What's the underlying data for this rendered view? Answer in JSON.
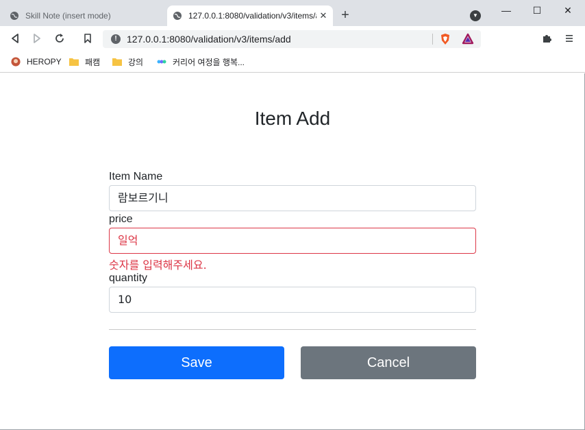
{
  "browser": {
    "tabs": [
      {
        "title": "Skill Note (insert mode)",
        "active": false
      },
      {
        "title": "127.0.0.1:8080/validation/v3/items/add",
        "active": true
      }
    ],
    "new_tab": "+",
    "window_buttons": {
      "minimize": "—",
      "maximize": "☐",
      "close": "✕"
    },
    "url": "127.0.0.1:8080/validation/v3/items/add",
    "bookmarks": [
      {
        "label": "HEROPY",
        "icon": "avatar-icon"
      },
      {
        "label": "패캠",
        "icon": "folder-icon"
      },
      {
        "label": "강의",
        "icon": "folder-icon"
      },
      {
        "label": "커리어 여정을 행복...",
        "icon": "dots-logo-icon"
      }
    ]
  },
  "form": {
    "title": "Item Add",
    "item_name": {
      "label": "Item Name",
      "value": "람보르기니"
    },
    "price": {
      "label": "price",
      "value": "일억",
      "error": "숫자를 입력해주세요."
    },
    "quantity": {
      "label": "quantity",
      "value": "10"
    },
    "save_label": "Save",
    "cancel_label": "Cancel"
  },
  "colors": {
    "primary": "#0d6efd",
    "secondary": "#6c757d",
    "danger": "#dc3545"
  }
}
